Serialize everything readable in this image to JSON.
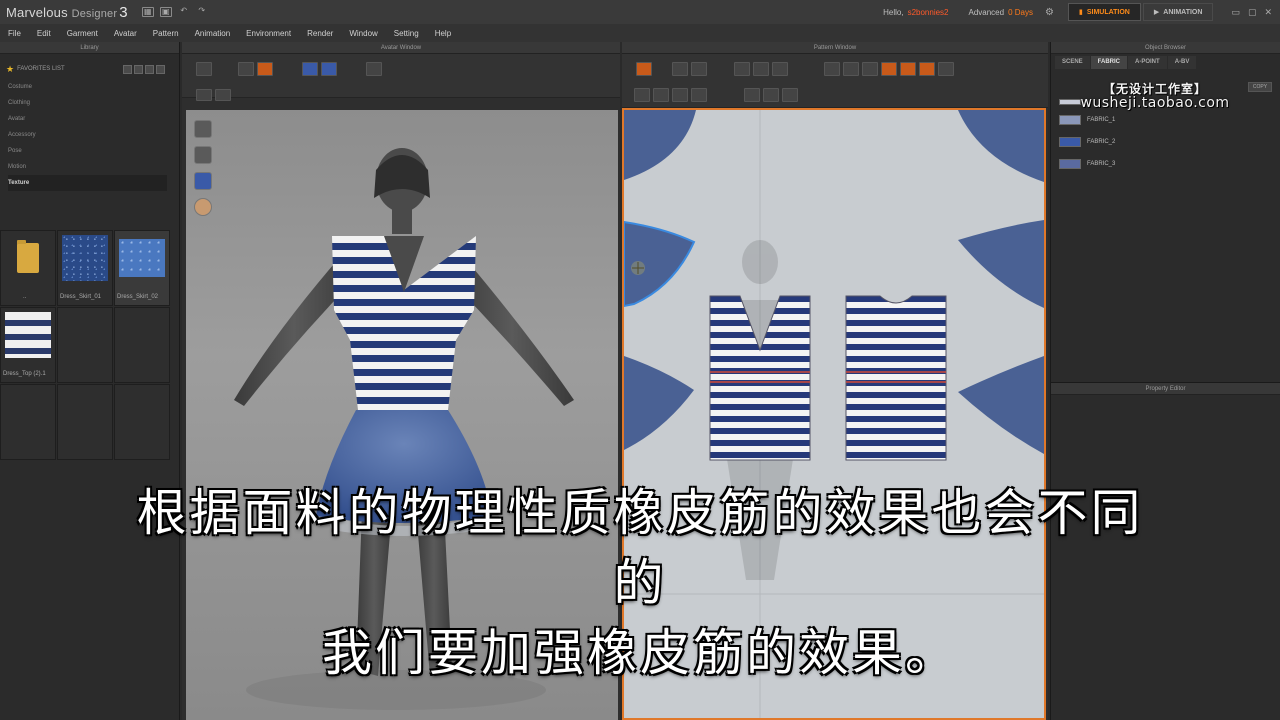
{
  "app": {
    "name": "Marvelous",
    "name_suffix": "Designer",
    "version": "3",
    "hello_label": "Hello,",
    "user": "s2bonnies2",
    "advanced_label": "Advanced",
    "days_left": "0 Days",
    "mode_simulation": "SIMULATION",
    "mode_animation": "ANIMATION"
  },
  "menu": [
    "File",
    "Edit",
    "Garment",
    "Avatar",
    "Pattern",
    "Animation",
    "Environment",
    "Render",
    "Window",
    "Setting",
    "Help"
  ],
  "library": {
    "title": "Library",
    "favorites_label": "FAVORITES LIST",
    "tree": [
      "Costume",
      "Clothing",
      "Avatar",
      "Accessory",
      "Pose",
      "Motion",
      "Texture"
    ],
    "selected": "Texture",
    "thumbs": [
      {
        "label": "..",
        "kind": "folder"
      },
      {
        "label": "Dress_Skirt_01",
        "kind": "fabric-dark"
      },
      {
        "label": "Dress_Skirt_02",
        "kind": "fabric-light"
      },
      {
        "label": "Dress_Top (2).1",
        "kind": "stripes"
      }
    ]
  },
  "avatar_window": {
    "title": "Avatar Window"
  },
  "pattern_window": {
    "title": "Pattern Window"
  },
  "object_browser": {
    "title": "Object Browser",
    "tabs": [
      "SCENE",
      "FABRIC",
      "A-POINT",
      "A-BV"
    ],
    "active_tab": "FABRIC",
    "copy_label": "COPY",
    "fabrics": [
      {
        "name": "FABRIC_1",
        "color": "#8a97b8"
      },
      {
        "name": "FABRIC_2",
        "color": "#3a5aa8"
      },
      {
        "name": "FABRIC_3",
        "color": "#5a6aa0"
      }
    ]
  },
  "property_editor": {
    "title": "Property Editor"
  },
  "watermark": {
    "cn": "【无设计工作室】",
    "url": "wusheji.taobao.com"
  },
  "subtitle": {
    "line1": "根据面料的物理性质橡皮筋的效果也会不同",
    "line2": "的",
    "line3": "我们要加强橡皮筋的效果。"
  },
  "colors": {
    "accent_orange": "#e0782a",
    "dress_blue": "#2a3a7a",
    "pattern_bg": "#c8ccd0"
  }
}
